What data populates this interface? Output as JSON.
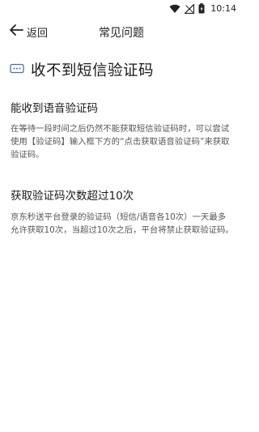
{
  "status_bar": {
    "time": "10:14",
    "icons": [
      "wifi-icon",
      "signal-icon",
      "battery-icon"
    ]
  },
  "nav": {
    "back_label": "返回",
    "title": "常见问题"
  },
  "heading": {
    "icon": "message-icon",
    "text": "收不到短信验证码"
  },
  "sections": [
    {
      "title": "能收到语音验证码",
      "body": "在等待一段时间之后仍然不能获取短信验证码时，可以尝试使用【验证码】输入框下方的“点击获取语音验证码”来获取验证码。"
    },
    {
      "title": "获取验证码次数超过10次",
      "body": "京东秒送平台登录的验证码（短信/语音各10次）一天最多允许获取10次，当超过10次之后，平台将禁止获取验证码。"
    }
  ],
  "colors": {
    "accent": "#4a6fa5",
    "text": "#222222",
    "body_text": "#555555",
    "background": "#ffffff"
  }
}
